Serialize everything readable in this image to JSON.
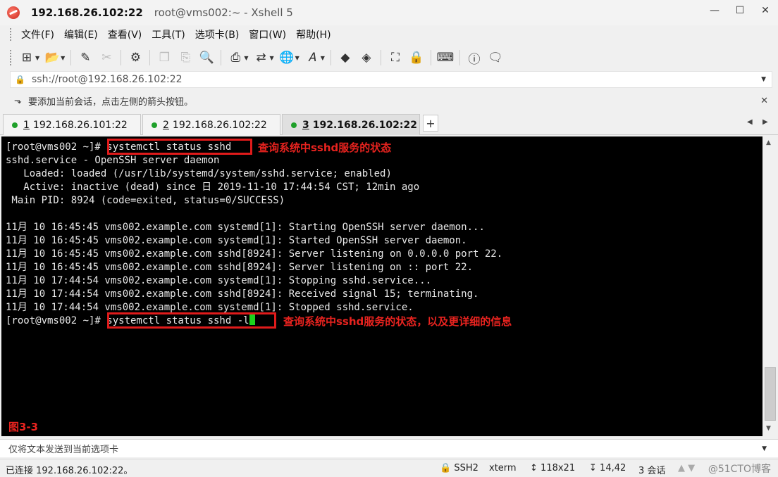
{
  "window": {
    "title_host": "192.168.26.102:22",
    "title_rest": "root@vms002:~ - Xshell 5"
  },
  "menu": [
    "文件(F)",
    "编辑(E)",
    "查看(V)",
    "工具(T)",
    "选项卡(B)",
    "窗口(W)",
    "帮助(H)"
  ],
  "address": {
    "value": "ssh://root@192.168.26.102:22"
  },
  "hint": {
    "text": "要添加当前会话，点击左侧的箭头按钮。"
  },
  "tabs": [
    {
      "num": "1",
      "label": "192.168.26.101:22",
      "active": false
    },
    {
      "num": "2",
      "label": "192.168.26.102:22",
      "active": false
    },
    {
      "num": "3",
      "label": "192.168.26.102:22",
      "active": true
    }
  ],
  "terminal": {
    "lines": [
      "[root@vms002 ~]# systemctl status sshd",
      "sshd.service - OpenSSH server daemon",
      "   Loaded: loaded (/usr/lib/systemd/system/sshd.service; enabled)",
      "   Active: inactive (dead) since 日 2019-11-10 17:44:54 CST; 12min ago",
      " Main PID: 8924 (code=exited, status=0/SUCCESS)",
      "",
      "11月 10 16:45:45 vms002.example.com systemd[1]: Starting OpenSSH server daemon...",
      "11月 10 16:45:45 vms002.example.com systemd[1]: Started OpenSSH server daemon.",
      "11月 10 16:45:45 vms002.example.com sshd[8924]: Server listening on 0.0.0.0 port 22.",
      "11月 10 16:45:45 vms002.example.com sshd[8924]: Server listening on :: port 22.",
      "11月 10 17:44:54 vms002.example.com systemd[1]: Stopping sshd.service...",
      "11月 10 17:44:54 vms002.example.com sshd[8924]: Received signal 15; terminating.",
      "11月 10 17:44:54 vms002.example.com systemd[1]: Stopped sshd.service.",
      "[root@vms002 ~]# systemctl status sshd -l"
    ],
    "annotation_1": "查询系统中sshd服务的状态",
    "annotation_2": "查询系统中sshd服务的状态，以及更详细的信息",
    "figure_label": "图3-3"
  },
  "sendbar": {
    "text": "仅将文本发送到当前选项卡"
  },
  "status": {
    "connected": "已连接 192.168.26.102:22。",
    "protocol": "SSH2",
    "term": "xterm",
    "size": "118x21",
    "cursor": "14,42",
    "sessions": "3 会话",
    "watermark": "@51CTO博客"
  },
  "colors": {
    "terminal_bg": "#000000",
    "terminal_fg": "#e8e8e8",
    "annotation": "#e8231f",
    "cursor": "#1cd31c",
    "tab_dot": "#1fa02a"
  }
}
